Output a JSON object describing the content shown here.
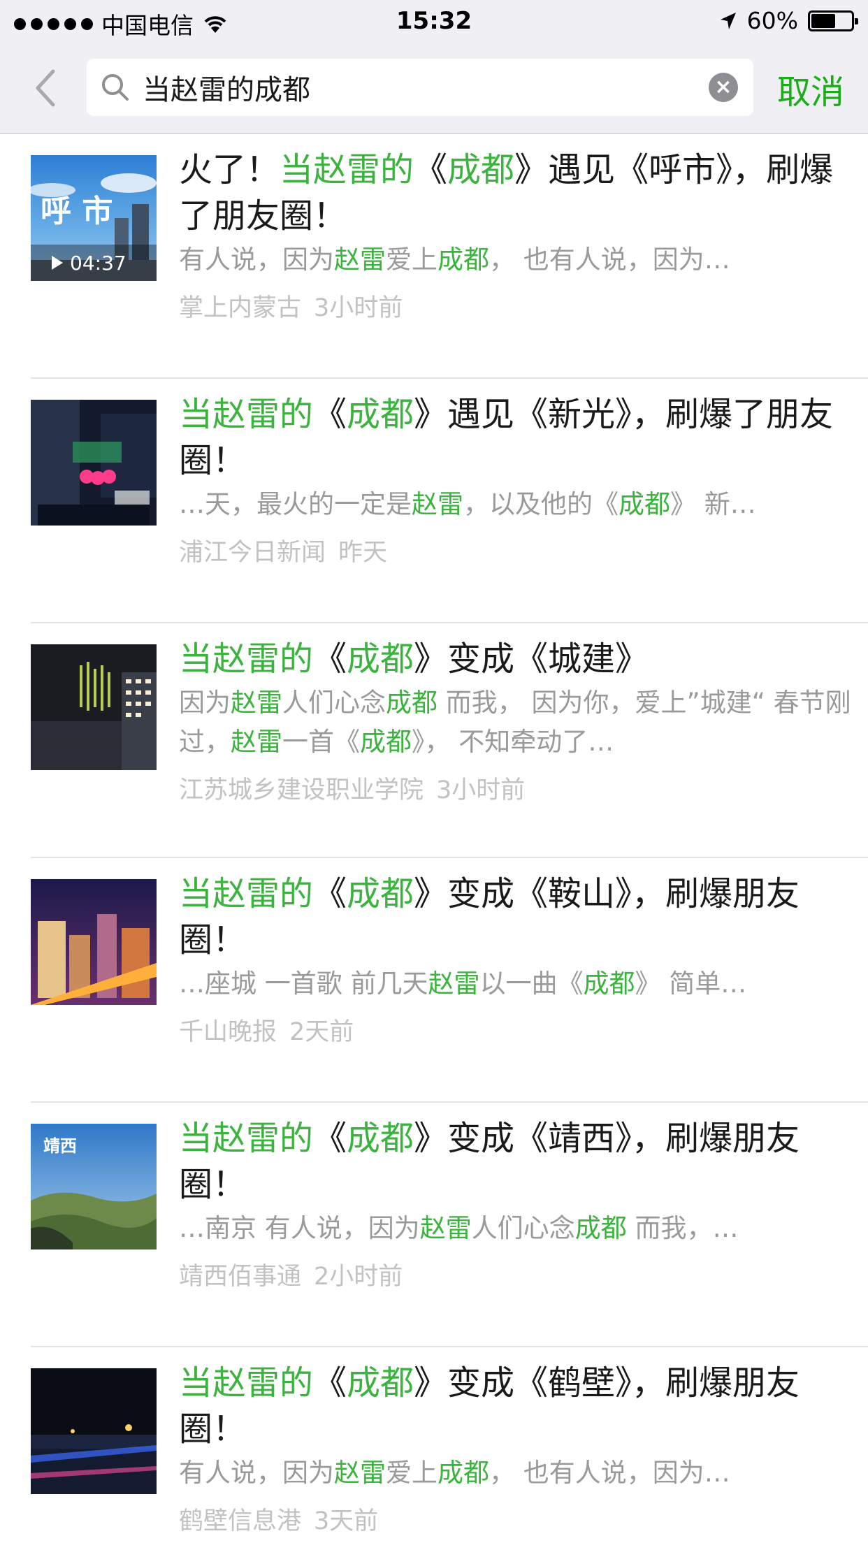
{
  "status": {
    "carrier": "中国电信",
    "time": "15:32",
    "battery_label": "60%",
    "battery_level": 0.6
  },
  "search": {
    "query": "当赵雷的成都",
    "cancel_label": "取消"
  },
  "results": [
    {
      "title": [
        [
          "火了！",
          false
        ],
        [
          "当赵雷的",
          true
        ],
        [
          "《",
          false
        ],
        [
          "成都",
          true
        ],
        [
          "》遇见《呼市》，刷爆了朋友圈！",
          false
        ]
      ],
      "snippet": [
        [
          "有人说，因为",
          false
        ],
        [
          "赵雷",
          true
        ],
        [
          "爱上",
          false
        ],
        [
          "成都",
          true
        ],
        [
          "，  也有人说，因为…",
          false
        ]
      ],
      "source": "掌上内蒙古",
      "time": "3小时前",
      "thumb_text": "呼 市",
      "duration": "04:37"
    },
    {
      "title": [
        [
          "当赵雷的",
          true
        ],
        [
          "《",
          false
        ],
        [
          "成都",
          true
        ],
        [
          "》遇见《新光》，刷爆了朋友圈！",
          false
        ]
      ],
      "snippet": [
        [
          "…天，最火的一定是",
          false
        ],
        [
          "赵雷",
          true
        ],
        [
          "，以及他的《",
          false
        ],
        [
          "成都",
          true
        ],
        [
          "》 新…",
          false
        ]
      ],
      "source": "浦江今日新闻",
      "time": "昨天"
    },
    {
      "title": [
        [
          "当赵雷的",
          true
        ],
        [
          "《",
          false
        ],
        [
          "成都",
          true
        ],
        [
          "》变成《城建》",
          false
        ]
      ],
      "snippet": [
        [
          "因为",
          false
        ],
        [
          "赵雷",
          true
        ],
        [
          "人们心念",
          false
        ],
        [
          "成都",
          true
        ],
        [
          " 而我，  因为你，爱上”城建“ 春节刚过，",
          false
        ],
        [
          "赵雷",
          true
        ],
        [
          "一首《",
          false
        ],
        [
          "成都",
          true
        ],
        [
          "》，  不知牵动了…",
          false
        ]
      ],
      "source": "江苏城乡建设职业学院",
      "time": "3小时前"
    },
    {
      "title": [
        [
          "当赵雷的",
          true
        ],
        [
          "《",
          false
        ],
        [
          "成都",
          true
        ],
        [
          "》变成《鞍山》，刷爆朋友圈！",
          false
        ]
      ],
      "snippet": [
        [
          "…座城 一首歌 前几天",
          false
        ],
        [
          "赵雷",
          true
        ],
        [
          "以一曲《",
          false
        ],
        [
          "成都",
          true
        ],
        [
          "》 简单…",
          false
        ]
      ],
      "source": "千山晚报",
      "time": "2天前"
    },
    {
      "title": [
        [
          "当赵雷的",
          true
        ],
        [
          "《",
          false
        ],
        [
          "成都",
          true
        ],
        [
          "》变成《靖西》，刷爆朋友圈！",
          false
        ]
      ],
      "snippet": [
        [
          "…南京 有人说，因为",
          false
        ],
        [
          "赵雷",
          true
        ],
        [
          "人们心念",
          false
        ],
        [
          "成都",
          true
        ],
        [
          " 而我，…",
          false
        ]
      ],
      "source": "靖西佰事通",
      "time": "2小时前",
      "thumb_text": "靖西"
    },
    {
      "title": [
        [
          "当赵雷的",
          true
        ],
        [
          "《",
          false
        ],
        [
          "成都",
          true
        ],
        [
          "》变成《鹤壁》，刷爆朋友圈！",
          false
        ]
      ],
      "snippet": [
        [
          "有人说，因为",
          false
        ],
        [
          "赵雷",
          true
        ],
        [
          "爱上",
          false
        ],
        [
          "成都",
          true
        ],
        [
          "，  也有人说，因为…",
          false
        ]
      ],
      "source": "鹤壁信息港",
      "time": "3天前"
    }
  ],
  "colors": {
    "accent": "#1aad19",
    "highlight": "#3bb33e",
    "header_bg": "#efeff4",
    "meta_text": "#c2c2c2"
  },
  "icons": [
    "signal-dots-icon",
    "wifi-icon",
    "location-arrow-icon",
    "battery-icon",
    "back-chevron-icon",
    "search-icon",
    "clear-icon",
    "play-icon"
  ]
}
